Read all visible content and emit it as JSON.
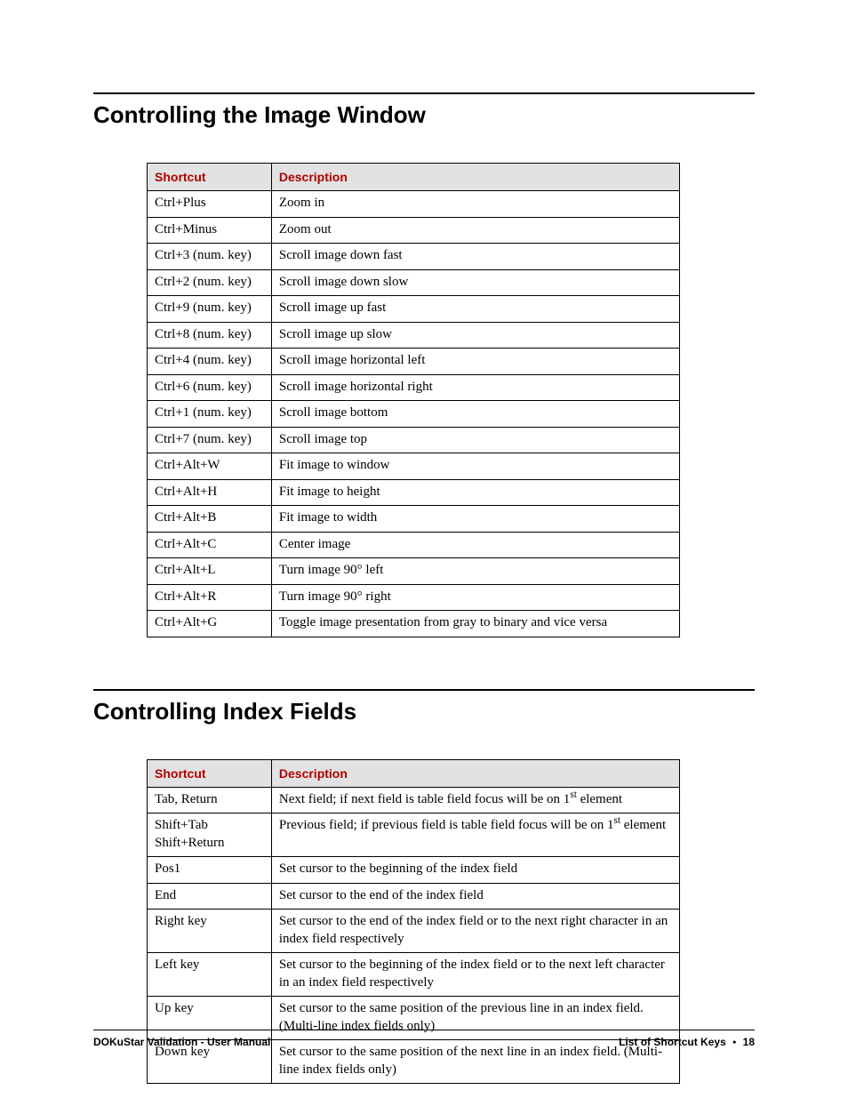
{
  "section1": {
    "title": "Controlling the Image Window",
    "headers": {
      "shortcut": "Shortcut",
      "description": "Description"
    },
    "rows": [
      {
        "shortcut": "Ctrl+Plus",
        "description": "Zoom in"
      },
      {
        "shortcut": "Ctrl+Minus",
        "description": "Zoom out"
      },
      {
        "shortcut": "Ctrl+3 (num. key)",
        "description": "Scroll image down fast"
      },
      {
        "shortcut": "Ctrl+2 (num. key)",
        "description": "Scroll image down slow"
      },
      {
        "shortcut": "Ctrl+9 (num. key)",
        "description": "Scroll image up fast"
      },
      {
        "shortcut": "Ctrl+8 (num. key)",
        "description": "Scroll image up slow"
      },
      {
        "shortcut": "Ctrl+4 (num. key)",
        "description": "Scroll image horizontal left"
      },
      {
        "shortcut": "Ctrl+6 (num. key)",
        "description": "Scroll image horizontal right"
      },
      {
        "shortcut": "Ctrl+1 (num. key)",
        "description": "Scroll image bottom"
      },
      {
        "shortcut": "Ctrl+7 (num. key)",
        "description": "Scroll image top"
      },
      {
        "shortcut": "Ctrl+Alt+W",
        "description": "Fit image to window"
      },
      {
        "shortcut": "Ctrl+Alt+H",
        "description": "Fit image to height"
      },
      {
        "shortcut": "Ctrl+Alt+B",
        "description": "Fit image to width"
      },
      {
        "shortcut": "Ctrl+Alt+C",
        "description": "Center image"
      },
      {
        "shortcut": "Ctrl+Alt+L",
        "description": "Turn image 90° left"
      },
      {
        "shortcut": "Ctrl+Alt+R",
        "description": "Turn image 90° right"
      },
      {
        "shortcut": "Ctrl+Alt+G",
        "description": "Toggle image presentation from gray to binary and vice versa"
      }
    ]
  },
  "section2": {
    "title": "Controlling Index Fields",
    "headers": {
      "shortcut": "Shortcut",
      "description": "Description"
    },
    "rows": [
      {
        "shortcut": "Tab, Return",
        "description_html": "Next field; if next field is table field focus will be on 1<span class=\"sup\">st</span> element"
      },
      {
        "shortcut_html": "Shift+Tab<br>Shift+Return",
        "description_html": "Previous field; if previous field is table field focus will be on 1<span class=\"sup\">st</span> element"
      },
      {
        "shortcut": "Pos1",
        "description": "Set cursor to the beginning of the index field"
      },
      {
        "shortcut": "End",
        "description": "Set cursor to the end of the index field"
      },
      {
        "shortcut": "Right key",
        "description": "Set cursor to the end of the index field or to the next right character in an index field respectively"
      },
      {
        "shortcut": "Left key",
        "description": "Set cursor to the beginning of the index field or to the next left character in an index field respectively"
      },
      {
        "shortcut": "Up key",
        "description": "Set cursor to the same position of the previous line in an index field. (Multi-line index fields only)"
      },
      {
        "shortcut": "Down key",
        "description": "Set cursor to the same position of the next line in an index field. (Multi-line index fields only)"
      }
    ]
  },
  "footer": {
    "left": "DOKuStar Validation - User Manual",
    "right_section": "List of Shortcut Keys",
    "right_page": "18"
  }
}
